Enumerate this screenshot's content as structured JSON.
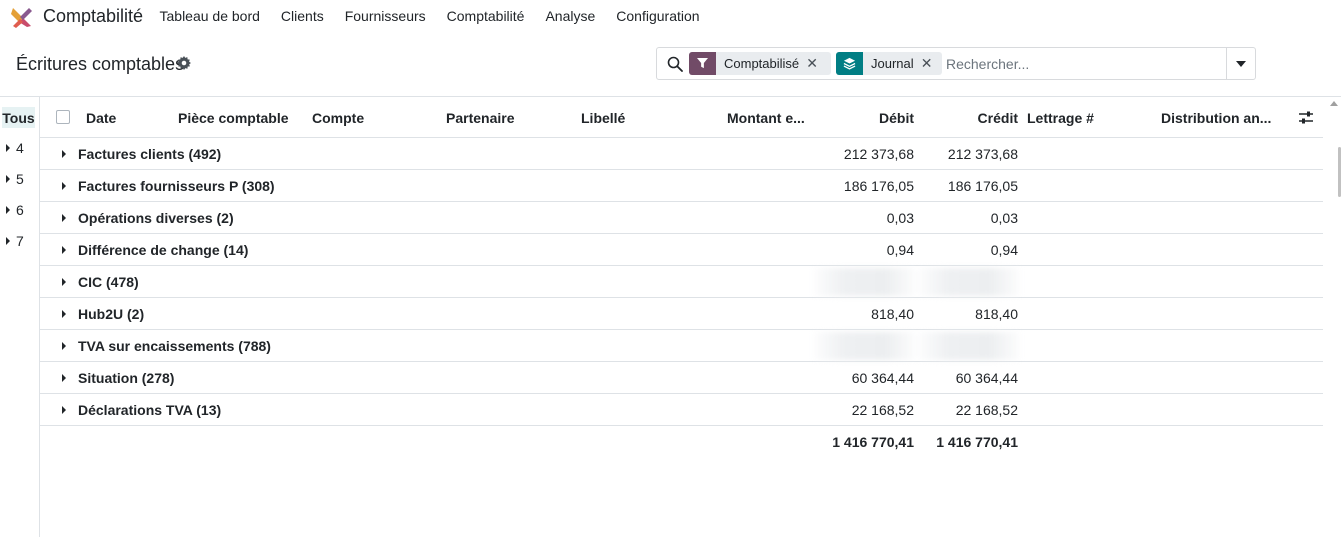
{
  "app": {
    "name": "Comptabilité",
    "menu": [
      "Tableau de bord",
      "Clients",
      "Fournisseurs",
      "Comptabilité",
      "Analyse",
      "Configuration"
    ]
  },
  "page": {
    "title": "Écritures comptables"
  },
  "search": {
    "facets": [
      {
        "label": "Comptabilisé",
        "icon": "filter-icon",
        "color": "#714B67"
      },
      {
        "label": "Journal",
        "icon": "layers-icon",
        "color": "#017e84"
      }
    ],
    "placeholder": "Rechercher..."
  },
  "sidepanel": {
    "all_label": "Tous",
    "items": [
      "4",
      "5",
      "6",
      "7"
    ]
  },
  "table": {
    "columns": [
      "Date",
      "Pièce comptable",
      "Compte",
      "Partenaire",
      "Libellé",
      "Montant e...",
      "Débit",
      "Crédit",
      "Lettrage #",
      "Distribution an..."
    ],
    "groups": [
      {
        "name": "Factures clients (492)",
        "debit": "212 373,68",
        "credit": "212 373,68"
      },
      {
        "name": "Factures fournisseurs P (308)",
        "debit": "186 176,05",
        "credit": "186 176,05"
      },
      {
        "name": "Opérations diverses (2)",
        "debit": "0,03",
        "credit": "0,03"
      },
      {
        "name": "Différence de change (14)",
        "debit": "0,94",
        "credit": "0,94"
      },
      {
        "name": "CIC (478)",
        "debit": "",
        "credit": "",
        "blurred": true
      },
      {
        "name": "Hub2U (2)",
        "debit": "818,40",
        "credit": "818,40"
      },
      {
        "name": "TVA sur encaissements (788)",
        "debit": "",
        "credit": "",
        "blurred": true
      },
      {
        "name": "Situation (278)",
        "debit": "60 364,44",
        "credit": "60 364,44"
      },
      {
        "name": "Déclarations TVA (13)",
        "debit": "22 168,52",
        "credit": "22 168,52"
      }
    ],
    "totals": {
      "debit": "1 416 770,41",
      "credit": "1 416 770,41"
    }
  }
}
